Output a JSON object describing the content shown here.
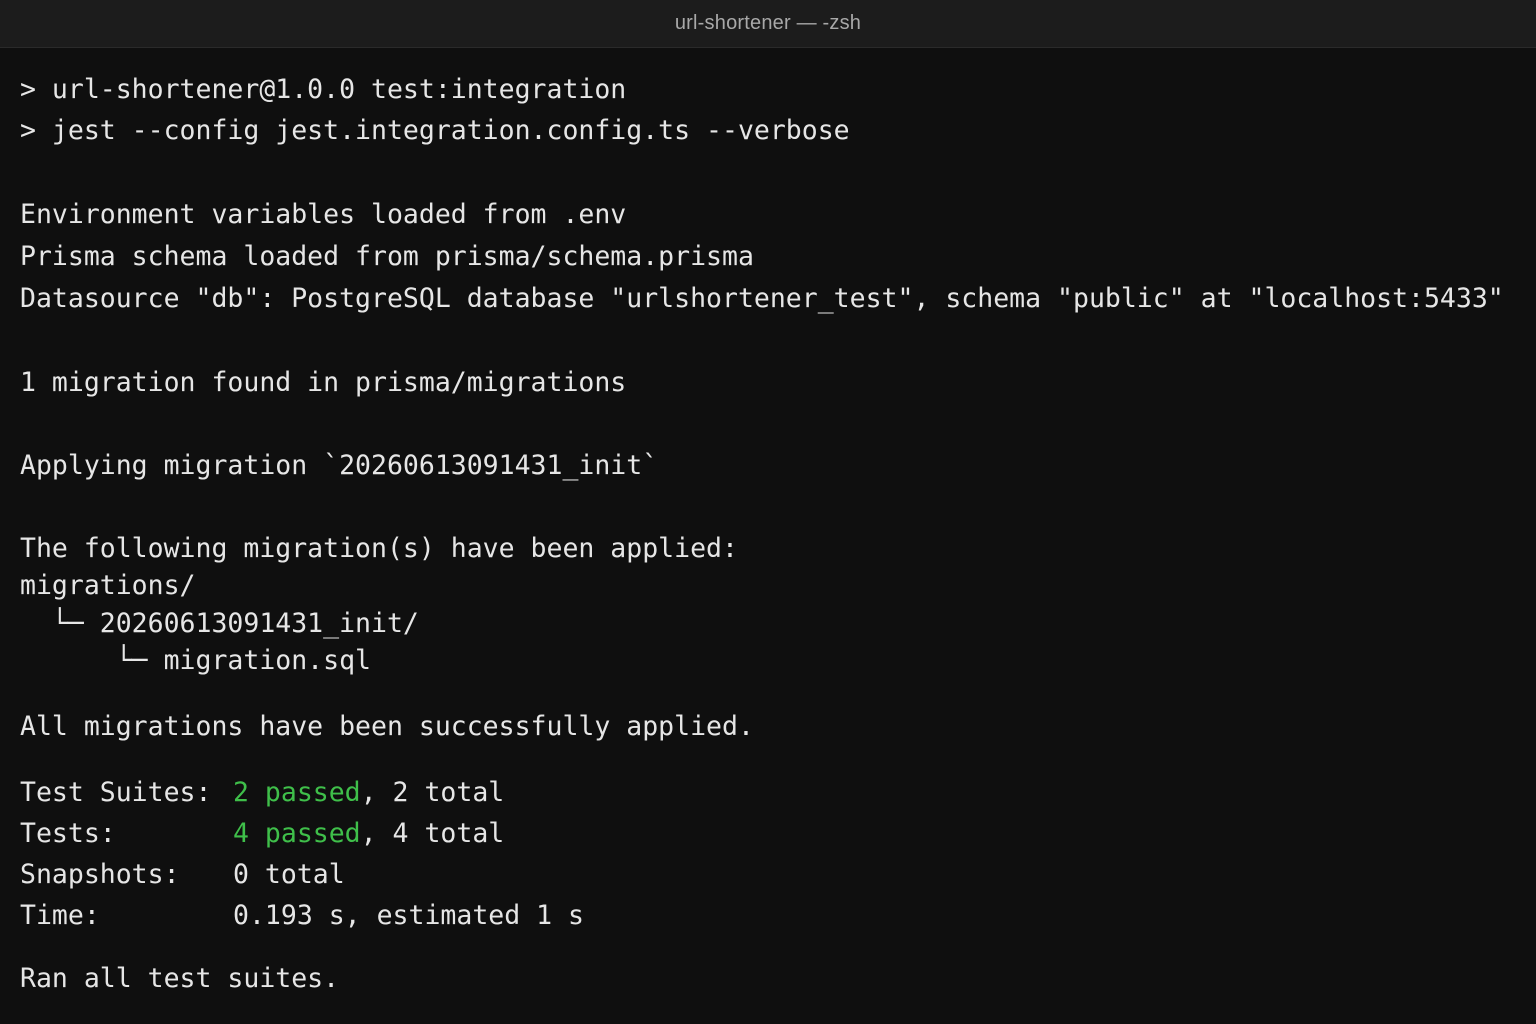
{
  "window": {
    "title": "url-shortener — -zsh"
  },
  "terminal": {
    "cmd_line_1": "> url-shortener@1.0.0 test:integration",
    "cmd_line_2": "> jest --config jest.integration.config.ts --verbose",
    "env_loaded": "Environment variables loaded from .env",
    "schema_loaded": "Prisma schema loaded from prisma/schema.prisma",
    "datasource": "Datasource \"db\": PostgreSQL database \"urlshortener_test\", schema \"public\" at \"localhost:5433\"",
    "migration_found": "1 migration found in prisma/migrations",
    "applying": "Applying migration `20260613091431_init`",
    "applied_header": "The following migration(s) have been applied:",
    "tree_root": "migrations/",
    "tree_dir": "  └─ 20260613091431_init/",
    "tree_file": "      └─ migration.sql",
    "all_applied": "All migrations have been successfully applied.",
    "summary": {
      "suites_label": "Test Suites:",
      "suites_passed": "2 passed",
      "suites_rest": ", 2 total",
      "tests_label": "Tests:",
      "tests_passed": "4 passed",
      "tests_rest": ", 4 total",
      "snapshots_label": "Snapshots:",
      "snapshots_value": "0 total",
      "time_label": "Time:",
      "time_value": "0.193 s, estimated 1 s"
    },
    "ran_all": "Ran all test suites."
  },
  "colors": {
    "background": "#0f0f0f",
    "titlebar": "#1c1c1c",
    "text": "#e6e6e6",
    "pass_green": "#3fbf4a"
  }
}
